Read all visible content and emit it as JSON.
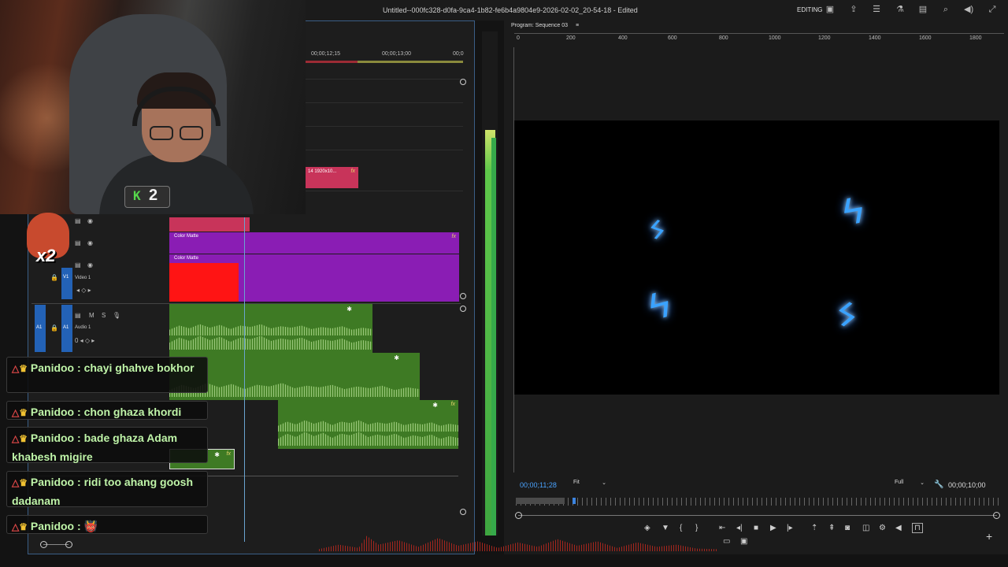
{
  "window": {
    "title": "Untitled--000fc328-d0fa-9ca4-1b82-fe6b4a9804e9-2026-02-02_20-54-18 - Edited",
    "workspace": "EDITING"
  },
  "timeline": {
    "ruler_timecodes": [
      "00;00;12;15",
      "00;00;13;00",
      "00;0"
    ],
    "clips": {
      "pink_label": "14 1920x10...",
      "color_matte_1": "Color Matte",
      "color_matte_2": "Color Matte",
      "fx": "fx"
    },
    "tracks": {
      "v1_button": "V1",
      "v1_name": "Video 1",
      "a1_button": "A1",
      "a1_target": "A1",
      "a1_name": "Audio 1",
      "a1_m": "M",
      "a1_s": "S"
    }
  },
  "program_monitor": {
    "tab_label": "Program: Sequence 03",
    "ruler": [
      "0",
      "200",
      "400",
      "600",
      "800",
      "1000",
      "1200",
      "1400",
      "1600",
      "1800"
    ],
    "current_timecode": "00;00;11;28",
    "zoom": "Fit",
    "resolution": "Full",
    "duration_timecode": "00;00;10;00"
  },
  "overlay": {
    "badge_k": "K",
    "badge_number": "2",
    "multiplier": "x2",
    "chat": [
      {
        "user": "Panidoo",
        "message": "chayi ghahve bokhor"
      },
      {
        "user": "Panidoo",
        "message": "chon ghaza khordi"
      },
      {
        "user": "Panidoo",
        "message": "bade ghaza Adam khabesh migire"
      },
      {
        "user": "Panidoo",
        "message": "ridi too ahang goosh dadanam"
      },
      {
        "user": "Panidoo",
        "message": "👹"
      }
    ]
  },
  "colors": {
    "accent": "#2362b6",
    "color_matte": "#8a1db4",
    "red_clip": "#ff1414",
    "pink_clip": "#c8345a",
    "audio_clip": "#3e7a24",
    "timecode_blue": "#4aa3ff",
    "lightning": "#3aa2ff"
  },
  "icons": [
    "layout-icon",
    "share-icon",
    "menu-icon",
    "flask-icon",
    "chat-icon",
    "zoom-icon",
    "volume-icon",
    "fullscreen-icon",
    "eye-icon",
    "lock-icon",
    "mic-icon",
    "wrench-icon",
    "play-icon",
    "stop-icon",
    "step-back-icon",
    "step-forward-icon",
    "camera-icon",
    "plus-icon"
  ]
}
